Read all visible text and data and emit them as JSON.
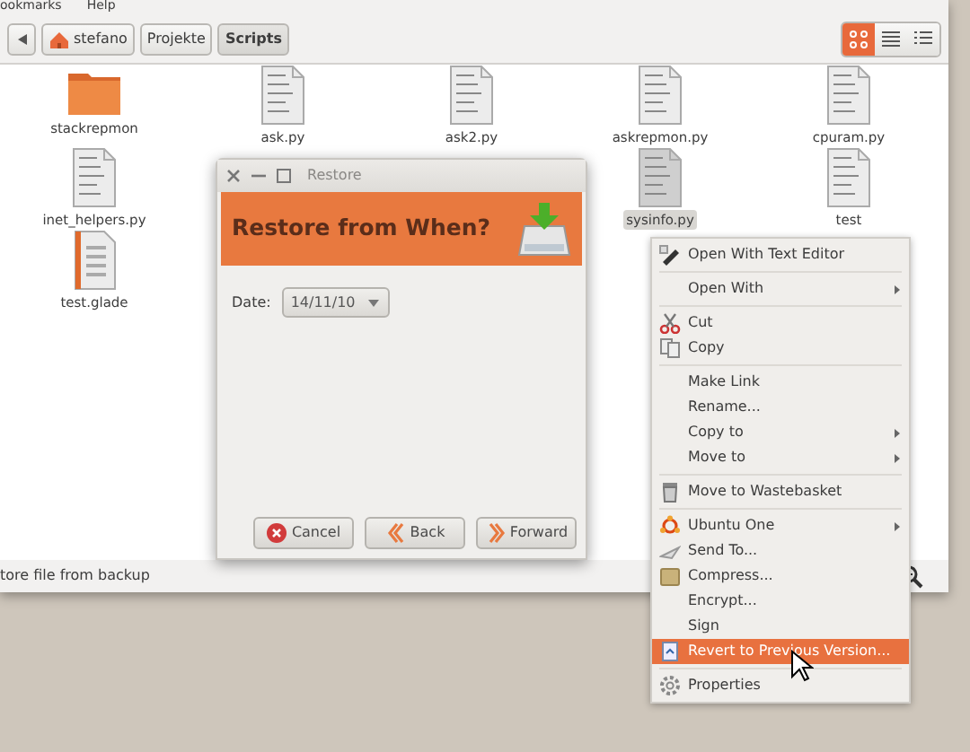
{
  "menubar": [
    "ookmarks",
    "Help"
  ],
  "toolbar": {
    "path": [
      {
        "label": "stefano",
        "home": true,
        "selected": false
      },
      {
        "label": "Projekte",
        "home": false,
        "selected": false
      },
      {
        "label": "Scripts",
        "home": false,
        "selected": true
      }
    ],
    "views": [
      {
        "selected": true
      },
      {
        "selected": false
      },
      {
        "selected": false
      }
    ]
  },
  "files": [
    {
      "name": "stackrepmon",
      "kind": "folder",
      "selected": false
    },
    {
      "name": "ask.py",
      "kind": "script",
      "selected": false
    },
    {
      "name": "ask2.py",
      "kind": "script",
      "selected": false
    },
    {
      "name": "askrepmon.py",
      "kind": "script",
      "selected": false
    },
    {
      "name": "cpuram.py",
      "kind": "script",
      "selected": false
    },
    {
      "name": "inet_helpers.py",
      "kind": "script",
      "selected": false
    },
    {
      "name": "sysinfo.py",
      "kind": "script",
      "selected": true
    },
    {
      "name": "test",
      "kind": "script",
      "selected": false
    },
    {
      "name": "test.glade",
      "kind": "glade",
      "selected": false
    }
  ],
  "dialog": {
    "title": "Restore",
    "heading": "Restore from When?",
    "date_label": "Date:",
    "date_value": "14/11/10",
    "buttons": [
      {
        "label": "Cancel"
      },
      {
        "label": "Back"
      },
      {
        "label": "Forward"
      }
    ]
  },
  "context_menu": {
    "groups": [
      [
        {
          "label": "Open With Text Editor",
          "submenu": false,
          "selected": false
        }
      ],
      [
        {
          "label": "Open With",
          "submenu": true,
          "selected": false
        }
      ],
      [
        {
          "label": "Cut",
          "submenu": false,
          "selected": false
        },
        {
          "label": "Copy",
          "submenu": false,
          "selected": false
        }
      ],
      [
        {
          "label": "Make Link",
          "submenu": false,
          "selected": false
        },
        {
          "label": "Rename...",
          "submenu": false,
          "selected": false
        },
        {
          "label": "Copy to",
          "submenu": true,
          "selected": false
        },
        {
          "label": "Move to",
          "submenu": true,
          "selected": false
        }
      ],
      [
        {
          "label": "Move to Wastebasket",
          "submenu": false,
          "selected": false
        }
      ],
      [
        {
          "label": "Ubuntu One",
          "submenu": true,
          "selected": false
        },
        {
          "label": "Send To...",
          "submenu": false,
          "selected": false
        },
        {
          "label": "Compress...",
          "submenu": false,
          "selected": false
        },
        {
          "label": "Encrypt...",
          "submenu": false,
          "selected": false
        },
        {
          "label": "Sign",
          "submenu": false,
          "selected": false
        },
        {
          "label": "Revert to Previous Version...",
          "submenu": false,
          "selected": true
        }
      ],
      [
        {
          "label": "Properties",
          "submenu": false,
          "selected": false
        }
      ]
    ]
  },
  "status_bar": "tore file from backup"
}
